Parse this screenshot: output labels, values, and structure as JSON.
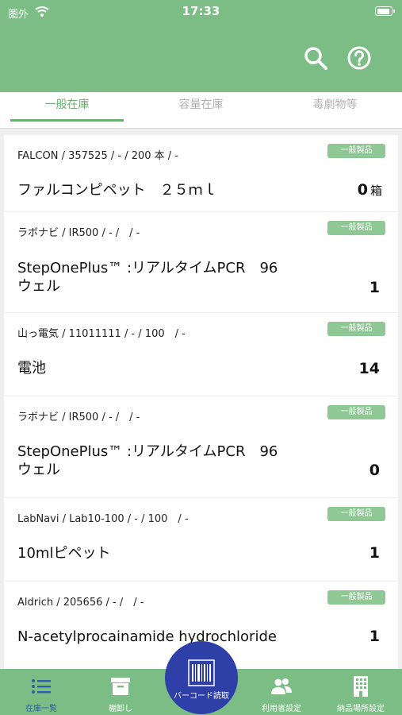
{
  "status_bar": {
    "carrier": "圏外",
    "time": "17:33"
  },
  "header": {
    "search_icon": "search-icon",
    "help_icon": "help-icon"
  },
  "tabs": [
    {
      "label": "一般在庫",
      "active": true
    },
    {
      "label": "容量在庫",
      "active": false
    },
    {
      "label": "毒劇物等",
      "active": false
    }
  ],
  "items": [
    {
      "meta": "FALCON / 357525 / - / 200 本 / -",
      "badge": "一般製品",
      "name": "ファルコンピペット　２５ｍｌ",
      "qty": "0",
      "unit": "箱"
    },
    {
      "meta": "ラボナビ / IR500 / - /　/ -",
      "badge": "一般製品",
      "name": "StepOnePlus™ :リアルタイムPCR　96 ウェル",
      "qty": "1",
      "unit": ""
    },
    {
      "meta": "山っ電気 / 11011111 / - / 100　/ -",
      "badge": "一般製品",
      "name": "電池",
      "qty": "14",
      "unit": ""
    },
    {
      "meta": "ラボナビ / IR500 / - /　/ -",
      "badge": "一般製品",
      "name": "StepOnePlus™ :リアルタイムPCR　96 ウェル",
      "qty": "0",
      "unit": ""
    },
    {
      "meta": "LabNavi / Lab10-100 / - / 100　/ -",
      "badge": "一般製品",
      "name": "10mlピペット",
      "qty": "1",
      "unit": ""
    },
    {
      "meta": "Aldrich / 205656 / - /　/ -",
      "badge": "一般製品",
      "name": "N-acetylprocainamide hydrochloride",
      "qty": "1",
      "unit": ""
    }
  ],
  "bottom_nav": {
    "list_label": "在庫一覧",
    "shelf_label": "棚卸し",
    "scan_label": "バーコード読取",
    "users_label": "利用者設定",
    "delivery_label": "納品場所設定"
  },
  "colors": {
    "primary": "#7bbd84",
    "tab_active": "#6dae75",
    "badge": "#8fc895",
    "scan_button": "#2f3fa8",
    "nav_active": "#2f5fa8"
  }
}
